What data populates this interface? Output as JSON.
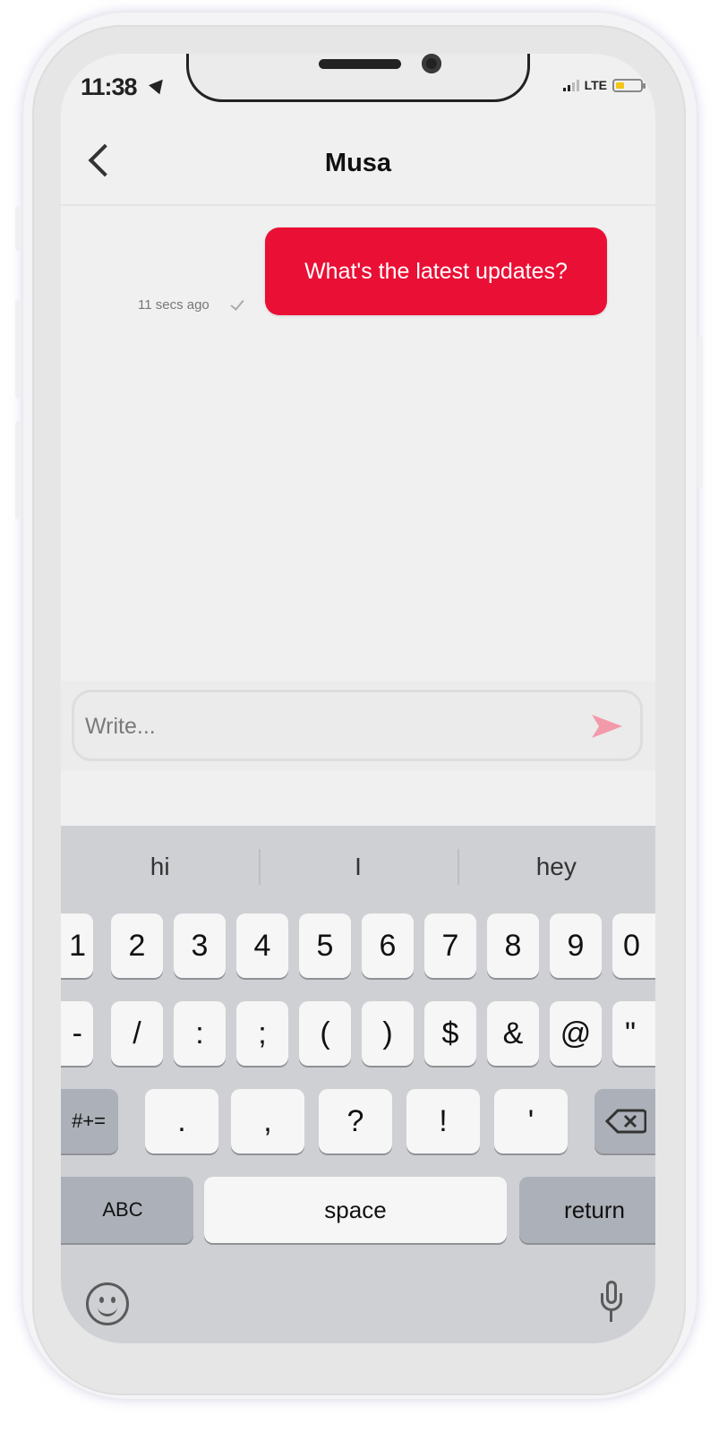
{
  "colors": {
    "accent": "#ea0f35",
    "battery": "#f5c419",
    "screen_bg": "#f0f0f0",
    "keyboard_bg": "#cfd0d4"
  },
  "status_bar": {
    "time": "11:38",
    "network": "LTE",
    "location_icon": "location-arrow-icon",
    "battery_icon": "battery-icon",
    "signal_icon": "signal-bars-icon"
  },
  "header": {
    "title": "Musa",
    "back_icon": "chevron-left-icon"
  },
  "messages": [
    {
      "text": "What's the latest updates?",
      "time": "11 secs ago",
      "status_icon": "checkmark-icon"
    }
  ],
  "composer": {
    "placeholder": "Write...",
    "send_icon": "send-arrow-icon"
  },
  "keyboard": {
    "suggestions": [
      "hi",
      "I",
      "hey"
    ],
    "row1": [
      "1",
      "2",
      "3",
      "4",
      "5",
      "6",
      "7",
      "8",
      "9",
      "0"
    ],
    "row2": [
      "-",
      "/",
      ":",
      ";",
      "(",
      ")",
      "$",
      "&",
      "@",
      "\""
    ],
    "row3_left": "#+=",
    "row3": [
      ".",
      ",",
      "?",
      "!",
      "'"
    ],
    "row3_right_icon": "backspace-icon",
    "abc": "ABC",
    "space": "space",
    "return": "return",
    "emoji_icon": "emoji-icon",
    "mic_icon": "microphone-icon"
  }
}
